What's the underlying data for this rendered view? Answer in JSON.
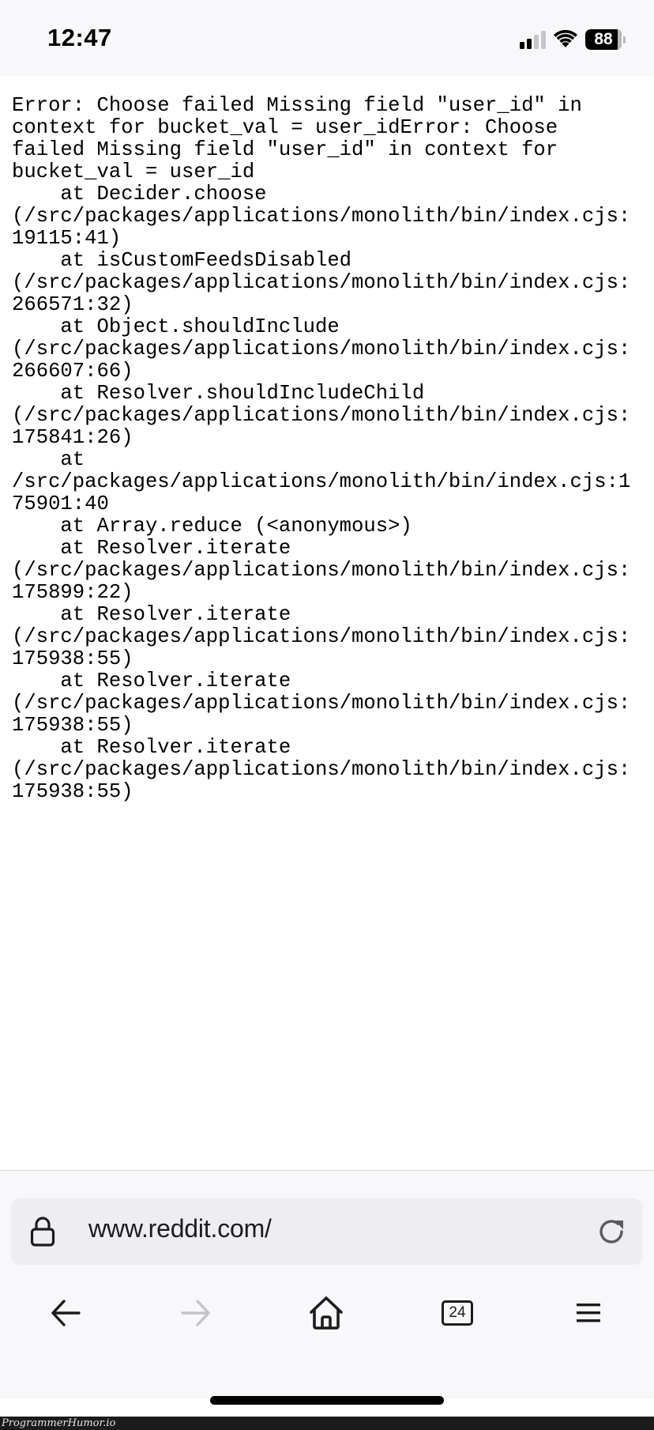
{
  "status_bar": {
    "time": "12:47",
    "signal_bars_active": 2,
    "signal_bars_total": 4,
    "wifi": "wifi-icon",
    "battery_level": "88"
  },
  "error_page": {
    "lines": [
      "Error: Choose failed Missing field \"user_id\" in",
      "context for bucket_val = user_idError: Choose",
      "failed Missing field \"user_id\" in context for",
      "bucket_val = user_id",
      "    at Decider.choose",
      "(/src/packages/applications/monolith/bin/index.cjs:",
      "19115:41)",
      "    at isCustomFeedsDisabled",
      "(/src/packages/applications/monolith/bin/index.cjs:",
      "266571:32)",
      "    at Object.shouldInclude",
      "(/src/packages/applications/monolith/bin/index.cjs:",
      "266607:66)",
      "    at Resolver.shouldIncludeChild",
      "(/src/packages/applications/monolith/bin/index.cjs:",
      "175841:26)",
      "    at",
      "/src/packages/applications/monolith/bin/index.cjs:1",
      "75901:40",
      "    at Array.reduce (<anonymous>)",
      "    at Resolver.iterate",
      "(/src/packages/applications/monolith/bin/index.cjs:",
      "175899:22)",
      "    at Resolver.iterate",
      "(/src/packages/applications/monolith/bin/index.cjs:",
      "175938:55)",
      "    at Resolver.iterate",
      "(/src/packages/applications/monolith/bin/index.cjs:",
      "175938:55)",
      "    at Resolver.iterate",
      "(/src/packages/applications/monolith/bin/index.cjs:",
      "175938:55)"
    ]
  },
  "browser": {
    "url": "www.reddit.com/",
    "lock_icon": "lock-icon",
    "reload_icon": "reload-icon",
    "nav": {
      "back": "back-arrow-icon",
      "forward": "forward-arrow-icon",
      "home": "home-icon",
      "tabs_count": "24",
      "menu": "hamburger-menu-icon"
    },
    "colors": {
      "toolbar_bg": "#f8f8fa",
      "urlbar_bg": "#ededf2",
      "icon_active": "#1c1c1e",
      "icon_disabled": "#c4c4c8"
    }
  },
  "watermark": "ProgrammerHumor.io"
}
